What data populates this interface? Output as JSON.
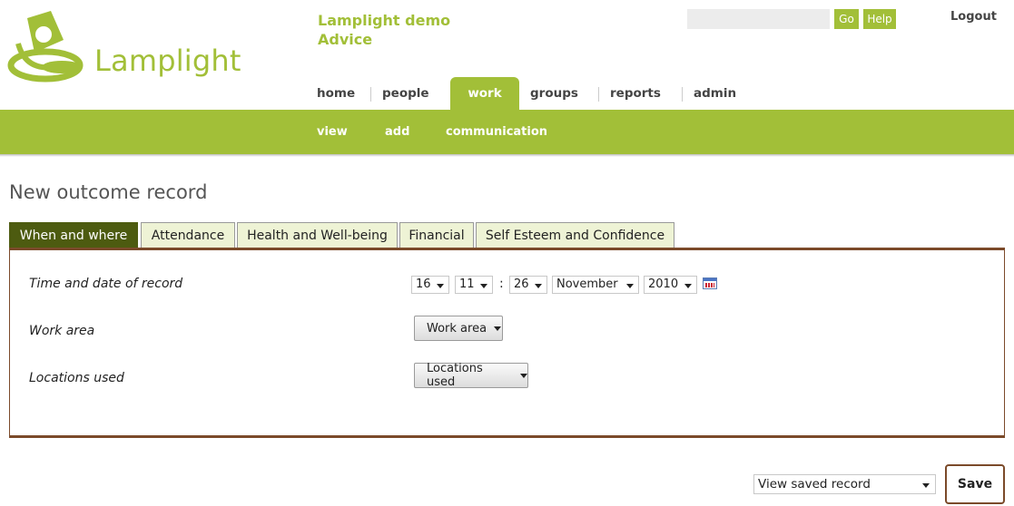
{
  "header": {
    "logo_text": "Lamplight",
    "org_line1": "Lamplight demo",
    "org_line2": "Advice",
    "search_placeholder": "",
    "go_label": "Go",
    "help_label": "Help",
    "logout_label": "Logout"
  },
  "nav": {
    "home": "home",
    "people": "people",
    "work": "work",
    "groups": "groups",
    "reports": "reports",
    "admin": "admin"
  },
  "subnav": {
    "view": "view",
    "add": "add",
    "communication": "communication"
  },
  "page": {
    "title": "New outcome record"
  },
  "tabs": {
    "when_where": "When and where",
    "attendance": "Attendance",
    "health": "Health and Well-being",
    "financial": "Financial",
    "self_esteem": "Self Esteem and Confidence"
  },
  "form": {
    "time_label": "Time and date of record",
    "day": "16",
    "hour": "11",
    "colon": ":",
    "minute": "26",
    "month": "November",
    "year": "2010",
    "work_area_label": "Work area",
    "work_area_button": "Work area",
    "locations_label": "Locations used",
    "locations_button": "Locations used"
  },
  "footer": {
    "view_saved_option": "View saved record",
    "save_label": "Save"
  },
  "colors": {
    "brand_green": "#a2bf38",
    "active_tab": "#4d5b10",
    "panel_border": "#7b4a2a"
  }
}
